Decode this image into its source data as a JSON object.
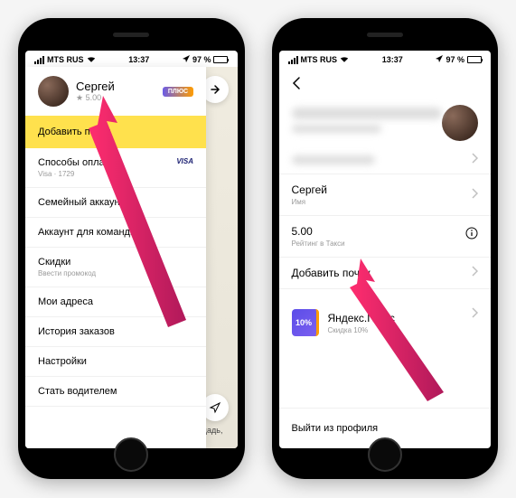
{
  "status": {
    "carrier": "MTS RUS",
    "time": "13:37",
    "battery": "97 %"
  },
  "left": {
    "profile": {
      "name": "Сергей",
      "rating_star": "★",
      "rating": "5.00",
      "badge": "ПЛЮС"
    },
    "highlight_label": "Добавить почту",
    "menu": [
      {
        "title": "Способы оплаты",
        "sub": "Visa · 1729",
        "has_visa": true
      },
      {
        "title": "Семейный аккаунт",
        "sub": ""
      },
      {
        "title": "Аккаунт для команды",
        "sub": ""
      },
      {
        "title": "Скидки",
        "sub": "Ввести промокод"
      },
      {
        "title": "Мои адреса",
        "sub": ""
      },
      {
        "title": "История заказов",
        "sub": ""
      },
      {
        "title": "Настройки",
        "sub": ""
      },
      {
        "title": "Стать водителем",
        "sub": ""
      }
    ],
    "map_label": "ощадь,",
    "visa_label": "VISA"
  },
  "right": {
    "rows": {
      "name_value": "Сергей",
      "name_label": "Имя",
      "rating_value": "5.00",
      "rating_label": "Рейтинг в Такси",
      "add_email": "Добавить почту"
    },
    "plus": {
      "pct": "10%",
      "title": "Яндекс.Плюс",
      "sub": "Скидка 10%"
    },
    "logout": "Выйти из профиля"
  }
}
